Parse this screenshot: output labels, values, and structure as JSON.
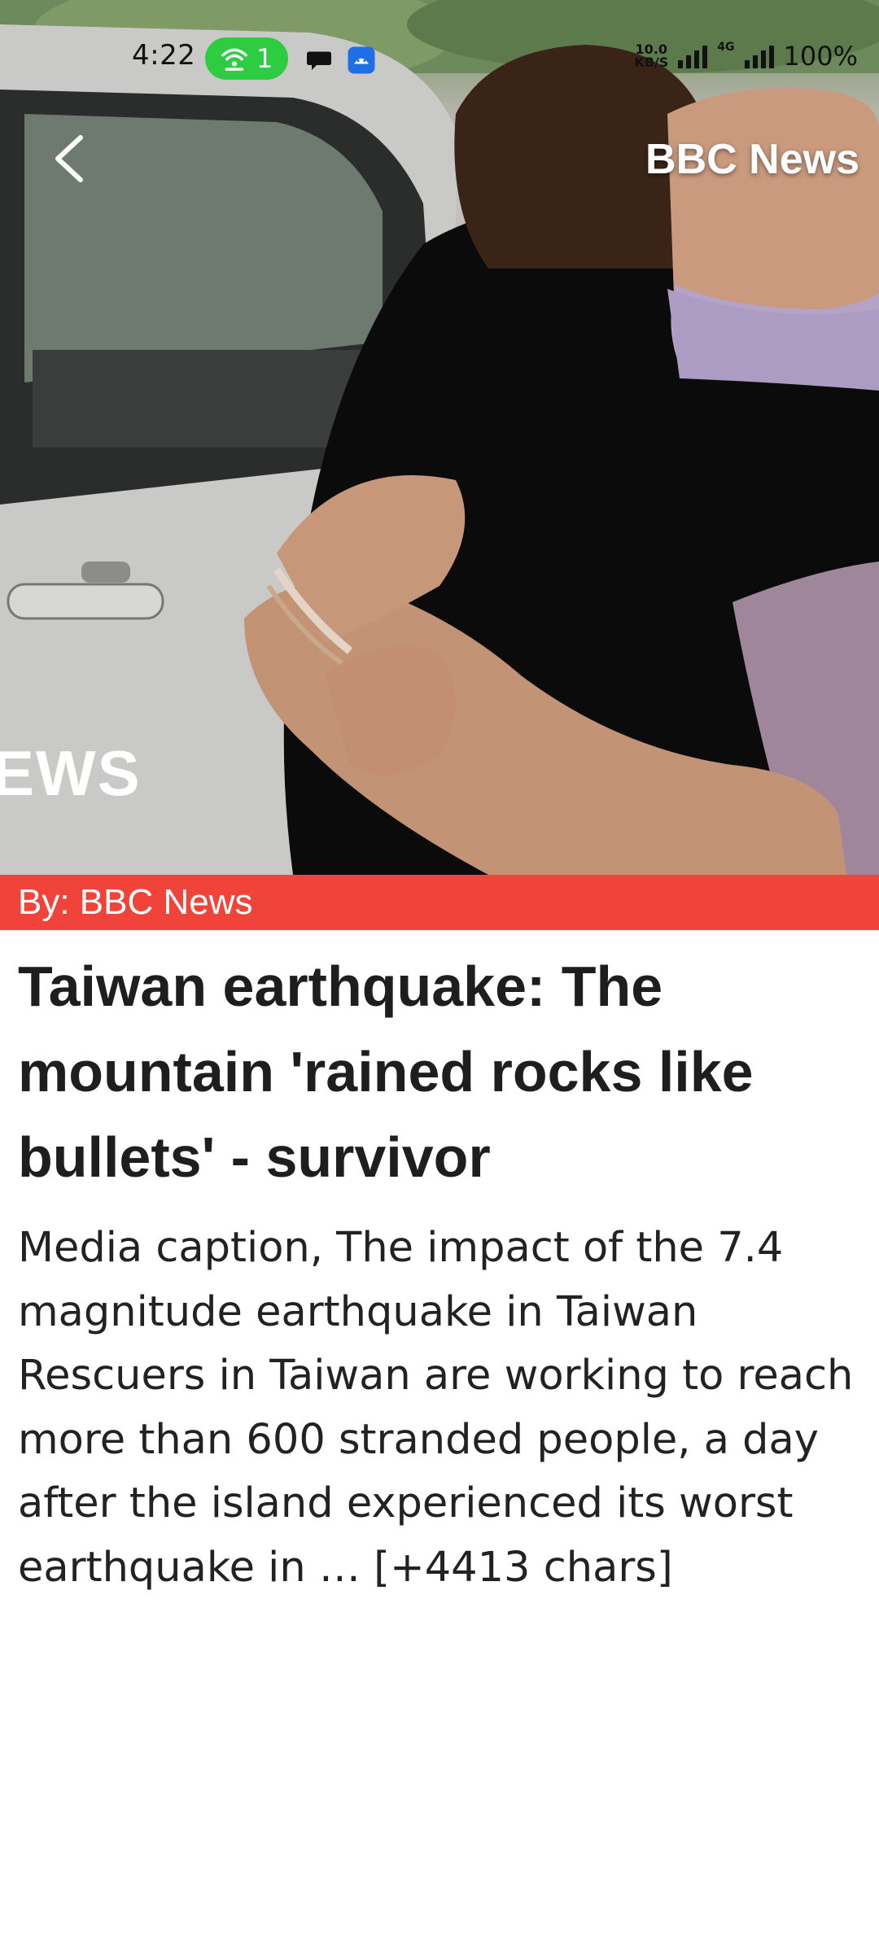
{
  "status_bar": {
    "time": "4:22",
    "hotspot_count": "1",
    "network_speed_top": "10.0",
    "network_speed_unit": "KB/S",
    "network_type": "4G",
    "battery": "100%"
  },
  "header": {
    "brand": "BBC News",
    "image_overlay_text": "EWS"
  },
  "byline": "By: BBC News",
  "article": {
    "title": "Taiwan earthquake: The mountain 'rained rocks like bullets' - survivor",
    "body": "Media caption, The impact of the 7.4 magnitude earthquake in Taiwan Rescuers in Taiwan are working to reach more than 600 stranded people, a day after the island experienced its worst earthquake in … [+4413 chars]"
  },
  "colors": {
    "byline_bg": "#f0443a",
    "hotspot_pill": "#2ecc40",
    "title_text": "#1e1e1e"
  },
  "icons": [
    "back-arrow-icon",
    "wifi-hotspot-icon",
    "chat-bubble-icon",
    "app-notification-icon",
    "signal-icon"
  ]
}
